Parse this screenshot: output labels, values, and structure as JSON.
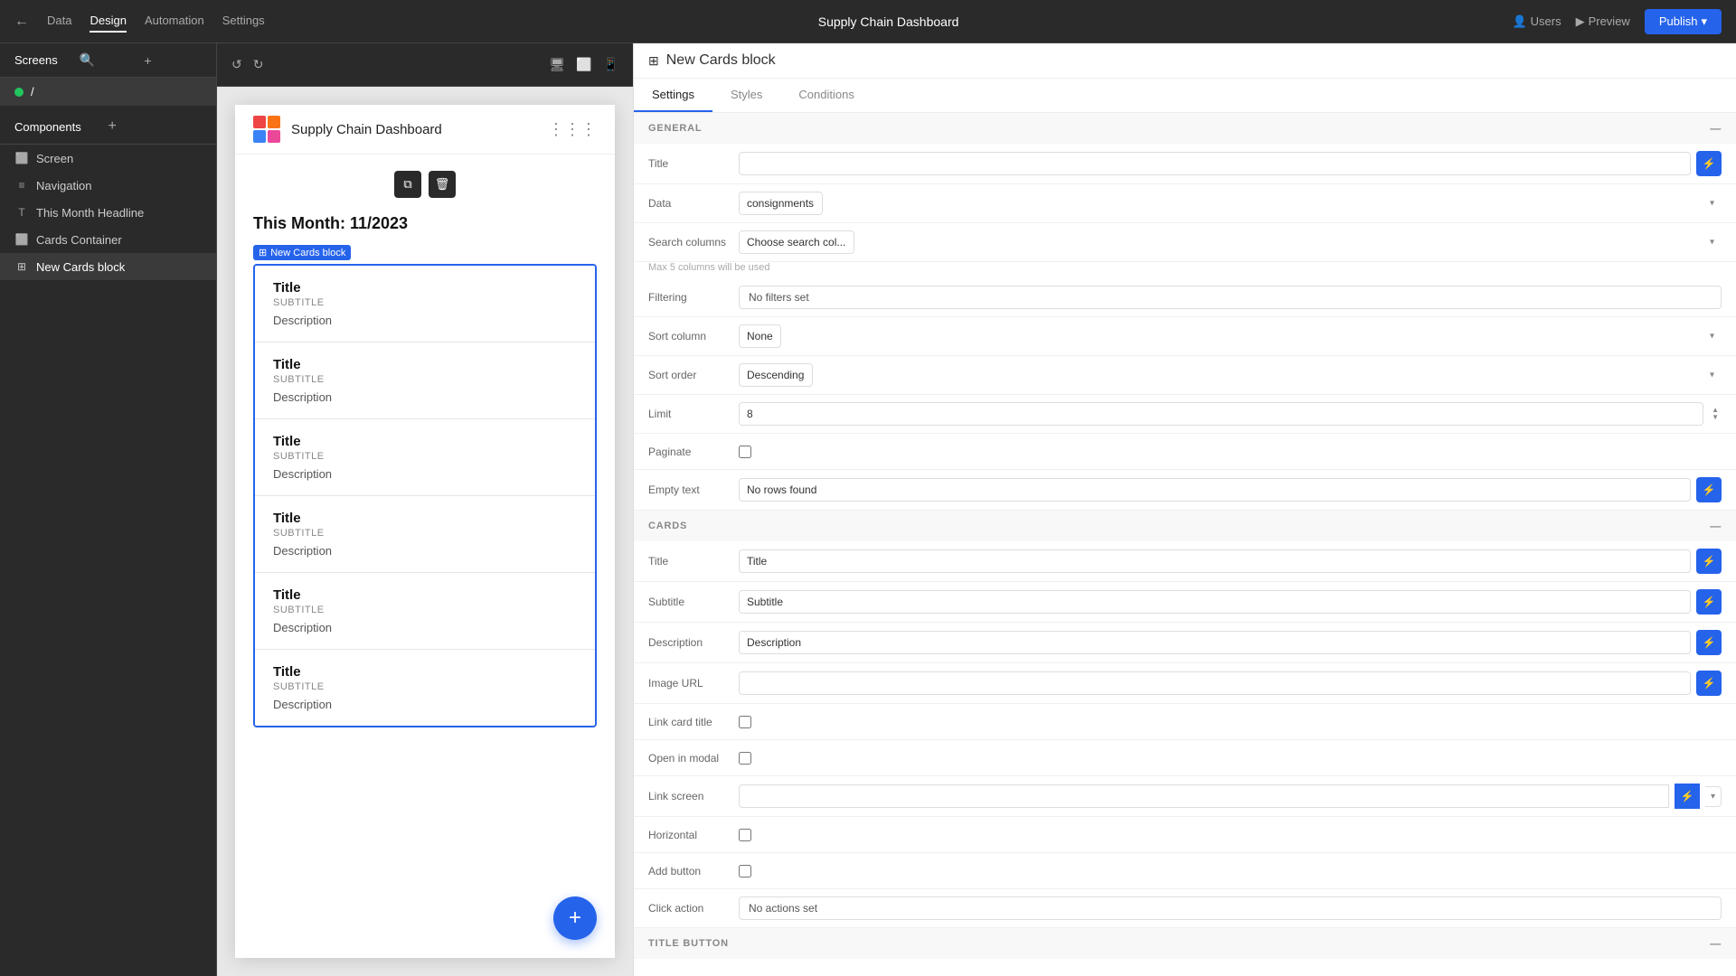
{
  "app": {
    "title": "Supply Chain Dashboard",
    "logo": [
      "red",
      "orange",
      "blue",
      "pink"
    ]
  },
  "topnav": {
    "back_label": "←",
    "tabs": [
      {
        "label": "Data",
        "active": false
      },
      {
        "label": "Design",
        "active": true
      },
      {
        "label": "Automation",
        "active": false
      },
      {
        "label": "Settings",
        "active": false
      }
    ],
    "users_label": "Users",
    "preview_label": "Preview",
    "publish_label": "Publish"
  },
  "toolbar": {
    "undo_label": "↺",
    "redo_label": "↻"
  },
  "sidebar": {
    "screens_label": "Screens",
    "screen_item": "/",
    "components_label": "Components",
    "items": [
      {
        "label": "Screen",
        "icon": "⬜",
        "indent": 0
      },
      {
        "label": "Navigation",
        "icon": "≡",
        "indent": 0
      },
      {
        "label": "This Month Headline",
        "icon": "T",
        "indent": 0
      },
      {
        "label": "Cards Container",
        "icon": "⬜",
        "indent": 0
      },
      {
        "label": "New Cards block",
        "icon": "⊞",
        "indent": 1,
        "active": true
      }
    ]
  },
  "canvas": {
    "month_headline": "This Month: 11/2023",
    "new_cards_block_label": "New Cards block",
    "cards": [
      {
        "title": "Title",
        "subtitle": "SUBTITLE",
        "description": "Description"
      },
      {
        "title": "Title",
        "subtitle": "SUBTITLE",
        "description": "Description"
      },
      {
        "title": "Title",
        "subtitle": "SUBTITLE",
        "description": "Description"
      },
      {
        "title": "Title",
        "subtitle": "SUBTITLE",
        "description": "Description"
      },
      {
        "title": "Title",
        "subtitle": "SUBTITLE",
        "description": "Description"
      },
      {
        "title": "Title",
        "subtitle": "SUBTITLE",
        "description": "Description"
      }
    ],
    "fab_label": "+"
  },
  "canvas_toolbar": {
    "duplicate_icon": "⧉",
    "delete_icon": "🗑"
  },
  "right_panel": {
    "block_label": "New Cards block",
    "tabs": [
      {
        "label": "Settings",
        "active": true
      },
      {
        "label": "Styles",
        "active": false
      },
      {
        "label": "Conditions",
        "active": false
      }
    ],
    "sections": {
      "general": {
        "label": "GENERAL",
        "fields": {
          "title_label": "Title",
          "title_value": "",
          "data_label": "Data",
          "data_value": "consignments",
          "search_columns_label": "Search columns",
          "search_columns_placeholder": "Choose search col...",
          "max_columns_note": "Max 5 columns will be used",
          "filtering_label": "Filtering",
          "filtering_value": "No filters set",
          "sort_column_label": "Sort column",
          "sort_column_value": "None",
          "sort_order_label": "Sort order",
          "sort_order_value": "Descending",
          "limit_label": "Limit",
          "limit_value": "8",
          "paginate_label": "Paginate",
          "paginate_checked": false,
          "empty_text_label": "Empty text",
          "empty_text_value": "No rows found"
        }
      },
      "cards": {
        "label": "CARDS",
        "fields": {
          "title_label": "Title",
          "title_value": "Title",
          "subtitle_label": "Subtitle",
          "subtitle_value": "Subtitle",
          "description_label": "Description",
          "description_value": "Description",
          "image_url_label": "Image URL",
          "image_url_value": "",
          "link_card_title_label": "Link card title",
          "link_card_title_checked": false,
          "open_in_modal_label": "Open in modal",
          "open_in_modal_checked": false,
          "link_screen_label": "Link screen",
          "link_screen_value": "",
          "horizontal_label": "Horizontal",
          "horizontal_checked": false,
          "add_button_label": "Add button",
          "add_button_checked": false,
          "click_action_label": "Click action",
          "click_action_value": "No actions set"
        }
      },
      "title_button": {
        "label": "TITLE BUTTON"
      }
    }
  }
}
